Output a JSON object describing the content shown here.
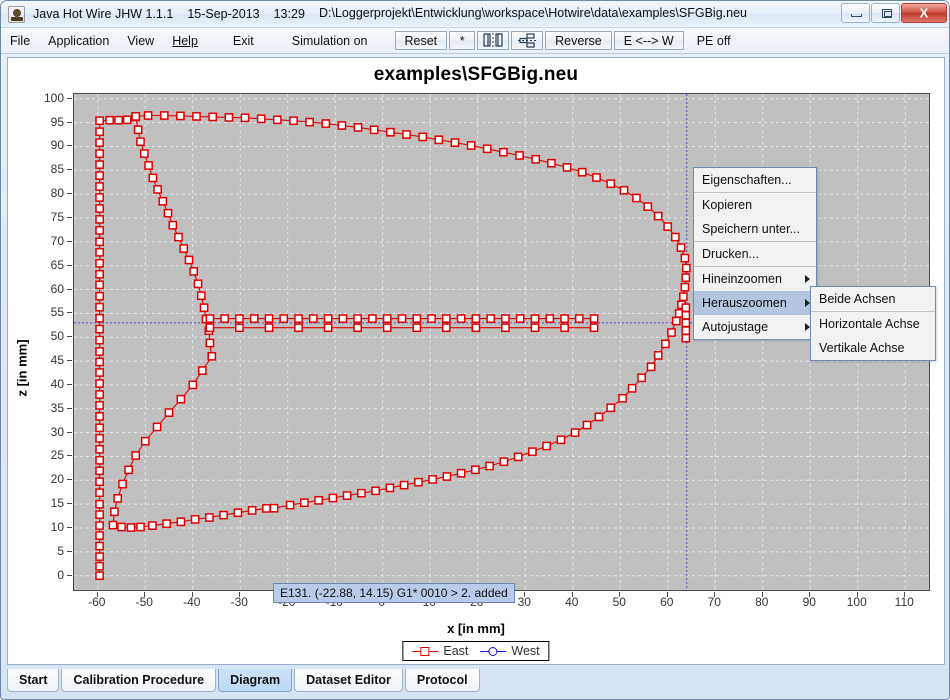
{
  "window": {
    "app_icon": "java-coffee-icon",
    "title": "Java Hot Wire JHW 1.1.1",
    "date": "15-Sep-2013",
    "time": "13:29",
    "path": "D:\\Loggerprojekt\\Entwicklung\\workspace\\Hotwire\\data\\examples\\SFGBig.neu",
    "buttons": {
      "minimize": "minimize-icon",
      "maximize": "maximize-icon",
      "close": "X"
    }
  },
  "menubar": {
    "items": [
      {
        "label": "File",
        "name": "menu-file"
      },
      {
        "label": "Application",
        "name": "menu-application"
      },
      {
        "label": "View",
        "name": "menu-view"
      },
      {
        "label": "Help",
        "name": "menu-help",
        "mnemonic": true
      }
    ],
    "exit_label": "Exit",
    "simulation_label": "Simulation on",
    "toolbar": [
      {
        "label": "Reset",
        "name": "toolbar-reset"
      },
      {
        "label": "*",
        "name": "toolbar-asterisk"
      },
      {
        "label": "",
        "name": "toolbar-mirror-icon"
      },
      {
        "label": "",
        "name": "toolbar-tree-icon"
      },
      {
        "label": "Reverse",
        "name": "toolbar-reverse"
      },
      {
        "label": "E <--> W",
        "name": "toolbar-east-west"
      }
    ],
    "pe_label": "PE off"
  },
  "chart_data": {
    "type": "line",
    "title": "examples\\SFGBig.neu",
    "xlabel": "x [in mm]",
    "ylabel": "z [in mm]",
    "xlim": [
      -65,
      115
    ],
    "ylim": [
      -3,
      101
    ],
    "xticks": [
      -60,
      -50,
      -40,
      -30,
      -20,
      -10,
      0,
      10,
      20,
      30,
      40,
      50,
      60,
      70,
      80,
      90,
      100,
      110
    ],
    "yticks": [
      0,
      5,
      10,
      15,
      20,
      25,
      30,
      35,
      40,
      45,
      50,
      55,
      60,
      65,
      70,
      75,
      80,
      85,
      90,
      95,
      100
    ],
    "grid": true,
    "legend_position": "bottom",
    "series": [
      {
        "name": "East",
        "color": "#e00000",
        "marker": "square",
        "points": [
          [
            -59.6,
            0.0
          ],
          [
            -59.6,
            2.0
          ],
          [
            -59.6,
            4.0
          ],
          [
            -59.6,
            6.2
          ],
          [
            -59.6,
            8.4
          ],
          [
            -59.6,
            10.5
          ],
          [
            -59.6,
            12.8
          ],
          [
            -59.6,
            15.0
          ],
          [
            -59.6,
            17.4
          ],
          [
            -59.6,
            19.7
          ],
          [
            -59.6,
            22.0
          ],
          [
            -59.6,
            24.2
          ],
          [
            -59.6,
            26.5
          ],
          [
            -59.6,
            28.8
          ],
          [
            -59.6,
            31.0
          ],
          [
            -59.6,
            33.4
          ],
          [
            -59.6,
            35.7
          ],
          [
            -59.6,
            38.0
          ],
          [
            -59.6,
            40.3
          ],
          [
            -59.6,
            42.6
          ],
          [
            -59.6,
            44.8
          ],
          [
            -59.6,
            47.0
          ],
          [
            -59.6,
            49.4
          ],
          [
            -59.6,
            51.7
          ],
          [
            -59.6,
            54.0
          ],
          [
            -59.6,
            56.3
          ],
          [
            -59.6,
            58.6
          ],
          [
            -59.6,
            61.0
          ],
          [
            -59.6,
            63.2
          ],
          [
            -59.6,
            65.5
          ],
          [
            -59.6,
            67.8
          ],
          [
            -59.6,
            70.0
          ],
          [
            -59.6,
            72.4
          ],
          [
            -59.6,
            74.7
          ],
          [
            -59.6,
            77.0
          ],
          [
            -59.6,
            79.3
          ],
          [
            -59.6,
            81.6
          ],
          [
            -59.6,
            83.9
          ],
          [
            -59.6,
            86.2
          ],
          [
            -59.6,
            88.5
          ],
          [
            -59.6,
            90.8
          ],
          [
            -59.6,
            93.1
          ],
          [
            -59.6,
            95.4
          ],
          [
            -57.5,
            95.5
          ],
          [
            -55.6,
            95.5
          ],
          [
            -53.8,
            95.6
          ],
          [
            -52.0,
            96.2
          ],
          [
            -51.5,
            93.5
          ],
          [
            -51.0,
            91.0
          ],
          [
            -50.2,
            88.5
          ],
          [
            -49.3,
            86.0
          ],
          [
            -48.4,
            83.4
          ],
          [
            -47.4,
            81.0
          ],
          [
            -46.3,
            78.5
          ],
          [
            -45.2,
            76.0
          ],
          [
            -44.2,
            73.5
          ],
          [
            -43.0,
            71.0
          ],
          [
            -41.9,
            68.6
          ],
          [
            -40.8,
            66.2
          ],
          [
            -39.8,
            63.8
          ],
          [
            -38.9,
            61.2
          ],
          [
            -38.2,
            58.7
          ],
          [
            -37.6,
            56.2
          ],
          [
            -37.2,
            53.8
          ],
          [
            -36.6,
            51.4
          ],
          [
            -36.4,
            48.8
          ],
          [
            -36.0,
            46.0
          ],
          [
            -38.0,
            43.0
          ],
          [
            -40.0,
            40.0
          ],
          [
            -42.5,
            37.0
          ],
          [
            -45.0,
            34.2
          ],
          [
            -47.5,
            31.2
          ],
          [
            -50.0,
            28.2
          ],
          [
            -52.0,
            25.2
          ],
          [
            -53.5,
            22.2
          ],
          [
            -54.8,
            19.2
          ],
          [
            -55.8,
            16.2
          ],
          [
            -56.5,
            13.4
          ],
          [
            -56.8,
            10.6
          ],
          [
            -55.0,
            10.2
          ],
          [
            -53.0,
            10.1
          ],
          [
            -51.0,
            10.2
          ],
          [
            -48.5,
            10.5
          ],
          [
            -45.5,
            10.9
          ],
          [
            -42.5,
            11.3
          ],
          [
            -39.5,
            11.8
          ],
          [
            -36.5,
            12.2
          ],
          [
            -33.5,
            12.7
          ],
          [
            -30.5,
            13.2
          ],
          [
            -27.5,
            13.7
          ],
          [
            -24.5,
            14.1
          ],
          [
            -22.88,
            14.15
          ],
          [
            -19.5,
            14.8
          ],
          [
            -16.5,
            15.3
          ],
          [
            -13.5,
            15.8
          ],
          [
            -10.5,
            16.3
          ],
          [
            -7.5,
            16.8
          ],
          [
            -4.5,
            17.3
          ],
          [
            -1.5,
            17.8
          ],
          [
            1.5,
            18.4
          ],
          [
            4.5,
            19.0
          ],
          [
            7.5,
            19.6
          ],
          [
            10.5,
            20.2
          ],
          [
            13.5,
            20.8
          ],
          [
            16.5,
            21.5
          ],
          [
            19.5,
            22.2
          ],
          [
            22.5,
            23.0
          ],
          [
            25.5,
            23.9
          ],
          [
            28.5,
            24.9
          ],
          [
            31.5,
            26.0
          ],
          [
            34.5,
            27.2
          ],
          [
            37.5,
            28.5
          ],
          [
            40.5,
            30.0
          ],
          [
            43.0,
            31.6
          ],
          [
            45.5,
            33.3
          ],
          [
            48.0,
            35.2
          ],
          [
            50.5,
            37.2
          ],
          [
            52.5,
            39.3
          ],
          [
            54.5,
            41.5
          ],
          [
            56.5,
            43.8
          ],
          [
            58.0,
            46.2
          ],
          [
            59.5,
            48.6
          ],
          [
            60.8,
            51.0
          ],
          [
            61.8,
            53.4
          ],
          [
            62.4,
            55.0
          ],
          [
            62.9,
            56.8
          ],
          [
            63.3,
            58.5
          ],
          [
            63.6,
            60.5
          ],
          [
            63.8,
            62.5
          ],
          [
            63.9,
            64.5
          ],
          [
            63.6,
            66.6
          ],
          [
            62.8,
            68.8
          ],
          [
            61.6,
            71.0
          ],
          [
            60.0,
            73.2
          ],
          [
            58.0,
            75.4
          ],
          [
            55.8,
            77.4
          ],
          [
            53.4,
            79.2
          ],
          [
            50.8,
            80.8
          ],
          [
            48.0,
            82.2
          ],
          [
            45.0,
            83.5
          ],
          [
            42.0,
            84.6
          ],
          [
            38.8,
            85.6
          ],
          [
            35.5,
            86.5
          ],
          [
            32.2,
            87.3
          ],
          [
            28.8,
            88.1
          ],
          [
            25.4,
            88.8
          ],
          [
            22.0,
            89.5
          ],
          [
            18.6,
            90.2
          ],
          [
            15.2,
            90.8
          ],
          [
            11.8,
            91.4
          ],
          [
            8.4,
            92.0
          ],
          [
            5.0,
            92.5
          ],
          [
            1.6,
            93.0
          ],
          [
            -1.8,
            93.5
          ],
          [
            -5.2,
            94.0
          ],
          [
            -8.6,
            94.4
          ],
          [
            -12.0,
            94.8
          ],
          [
            -15.4,
            95.1
          ],
          [
            -18.8,
            95.4
          ],
          [
            -22.2,
            95.6
          ],
          [
            -25.6,
            95.8
          ],
          [
            -29.0,
            96.0
          ],
          [
            -32.4,
            96.1
          ],
          [
            -35.8,
            96.2
          ],
          [
            -39.2,
            96.3
          ],
          [
            -42.6,
            96.4
          ],
          [
            -46.0,
            96.5
          ],
          [
            -49.4,
            96.5
          ],
          [
            -52.0,
            96.3
          ]
        ]
      },
      {
        "name": "West",
        "color": "#1414e0",
        "marker": "circle",
        "points": []
      }
    ],
    "horizontal_band": {
      "y_upper": 53.9,
      "y_lower": 52.0,
      "x_start": -36.4,
      "x_end": 44.5
    },
    "crosshair": {
      "x": 64.0,
      "y": 53.0,
      "color": "#4a4ad0"
    },
    "annotation": {
      "text": "E131. (-22.88, 14.15)  G1* 0010 > 2. added",
      "x": -22.88,
      "y": 14.15
    }
  },
  "legend": [
    {
      "label": "East",
      "marker": "square-marker",
      "color": "#e00000"
    },
    {
      "label": "West",
      "marker": "circle-marker",
      "color": "#1414e0"
    }
  ],
  "context_menu": {
    "items": [
      {
        "label": "Eigenschaften...",
        "name": "ctx-eigenschaften",
        "submenu": false,
        "highlighted": false,
        "separator_after": true
      },
      {
        "label": "Kopieren",
        "name": "ctx-kopieren",
        "submenu": false,
        "highlighted": false,
        "separator_after": false
      },
      {
        "label": "Speichern unter...",
        "name": "ctx-speichern-unter",
        "submenu": false,
        "highlighted": false,
        "separator_after": true
      },
      {
        "label": "Drucken...",
        "name": "ctx-drucken",
        "submenu": false,
        "highlighted": false,
        "separator_after": true
      },
      {
        "label": "Hineinzoomen",
        "name": "ctx-hineinzoomen",
        "submenu": true,
        "highlighted": false,
        "separator_after": false
      },
      {
        "label": "Herauszoomen",
        "name": "ctx-herauszoomen",
        "submenu": true,
        "highlighted": true,
        "separator_after": false
      },
      {
        "label": "Autojustage",
        "name": "ctx-autojustage",
        "submenu": true,
        "highlighted": false,
        "separator_after": false
      }
    ],
    "submenu": {
      "items": [
        {
          "label": "Beide Achsen",
          "name": "submenu-beide-achsen"
        },
        {
          "label": "Horizontale Achse",
          "name": "submenu-horizontale-achse"
        },
        {
          "label": "Vertikale Achse",
          "name": "submenu-vertikale-achse"
        }
      ]
    }
  },
  "tabs": [
    {
      "label": "Start",
      "name": "tab-start",
      "selected": false
    },
    {
      "label": "Calibration Procedure",
      "name": "tab-calibration-procedure",
      "selected": false
    },
    {
      "label": "Diagram",
      "name": "tab-diagram",
      "selected": true
    },
    {
      "label": "Dataset Editor",
      "name": "tab-dataset-editor",
      "selected": false
    },
    {
      "label": "Protocol",
      "name": "tab-protocol",
      "selected": false
    }
  ]
}
